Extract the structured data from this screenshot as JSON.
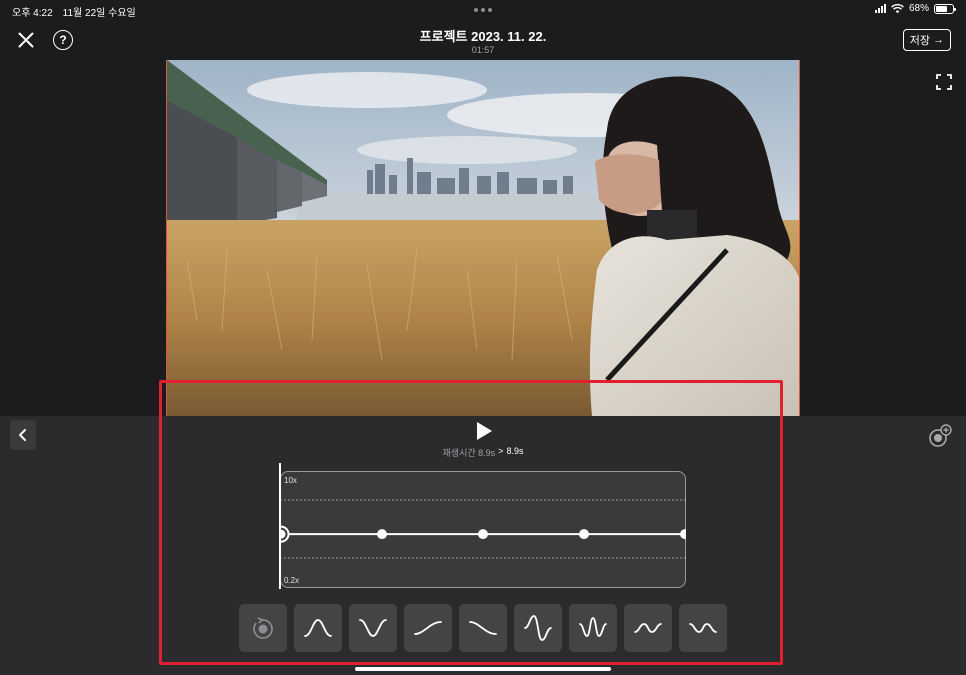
{
  "status_bar": {
    "time": "오후 4:22",
    "date": "11월 22일 수요일",
    "battery_percent": "68%",
    "battery_level": 0.68
  },
  "top_bar": {
    "close_icon": "close-icon",
    "help_icon": "help-icon",
    "help_glyph": "?",
    "title": "프로젝트 2023. 11. 22.",
    "duration": "01:57",
    "save_label": "저장",
    "save_arrow": "→"
  },
  "preview": {
    "fullscreen_icon": "fullscreen-icon"
  },
  "editor": {
    "back_icon": "chevron-left-icon",
    "fx_icon": "effects-icon",
    "play_icon": "play-icon",
    "playback_label": "재생시간 8.9s",
    "playback_arrow": ">",
    "playback_result": "8.9s",
    "speed_graph": {
      "max_label": "10x",
      "min_label": "0.2x",
      "points": [
        1,
        1,
        1,
        1,
        1
      ],
      "selected_point": 0
    },
    "presets": [
      {
        "name": "reset-icon"
      },
      {
        "name": "bump-up-icon"
      },
      {
        "name": "bump-down-icon"
      },
      {
        "name": "ramp-up-icon"
      },
      {
        "name": "ramp-down-icon"
      },
      {
        "name": "pulse-up-down-icon"
      },
      {
        "name": "pulse-down-up-icon"
      },
      {
        "name": "wave-down-up-icon"
      },
      {
        "name": "wave-up-down-icon"
      }
    ]
  },
  "colors": {
    "background": "#1c1c1e",
    "panel": "#2b2b2d",
    "highlight": "#e02030",
    "frame_border": "#d65a3a"
  }
}
